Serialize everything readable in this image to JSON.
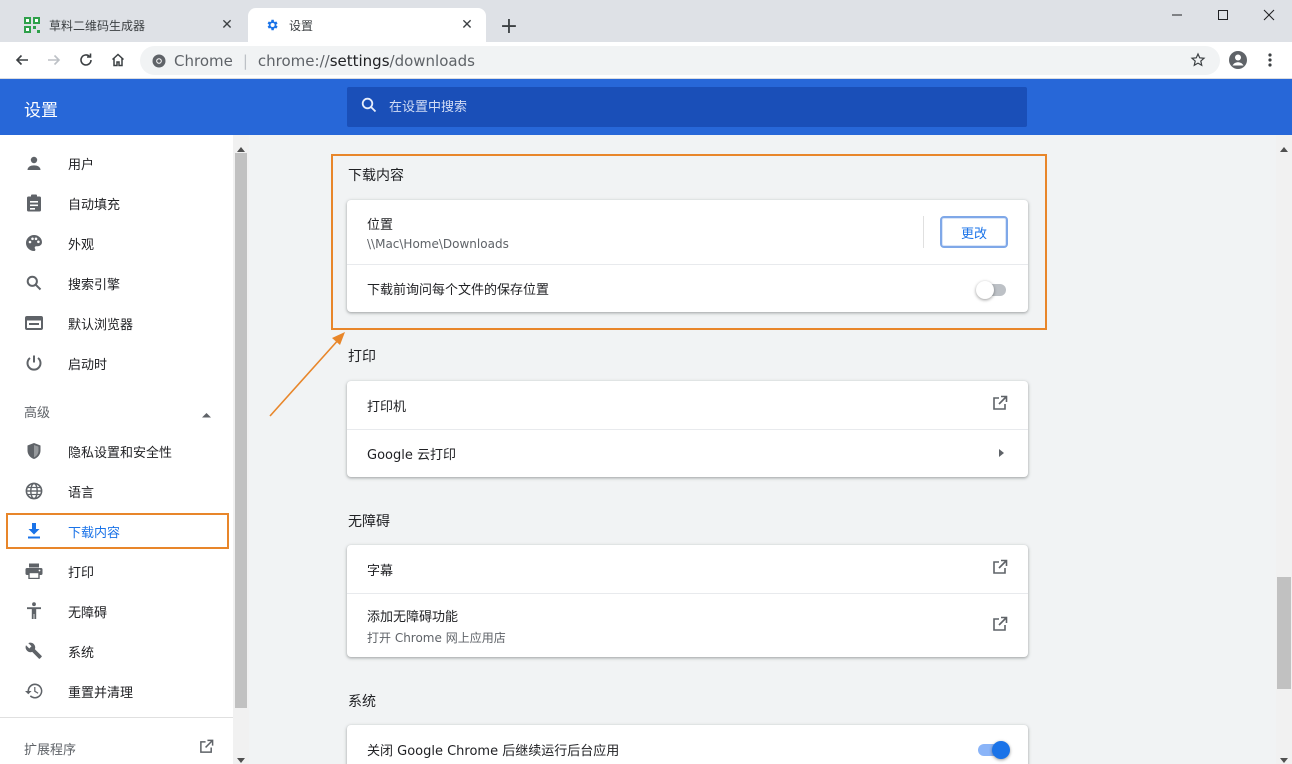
{
  "browser": {
    "tabs": [
      {
        "title": "草料二维码生成器",
        "active": false
      },
      {
        "title": "设置",
        "active": true
      }
    ],
    "omnibox": {
      "chip": "Chrome",
      "url_prefix": "chrome://",
      "url_host": "settings",
      "url_path": "/downloads"
    }
  },
  "header": {
    "title": "设置",
    "search_placeholder": "在设置中搜索"
  },
  "sidebar": {
    "items": [
      {
        "label": "用户",
        "icon": "person-icon"
      },
      {
        "label": "自动填充",
        "icon": "clipboard-icon"
      },
      {
        "label": "外观",
        "icon": "palette-icon"
      },
      {
        "label": "搜索引擎",
        "icon": "search-icon"
      },
      {
        "label": "默认浏览器",
        "icon": "browser-icon"
      },
      {
        "label": "启动时",
        "icon": "power-icon"
      }
    ],
    "advanced_label": "高级",
    "advanced_items": [
      {
        "label": "隐私设置和安全性",
        "icon": "shield-icon"
      },
      {
        "label": "语言",
        "icon": "globe-icon"
      },
      {
        "label": "下载内容",
        "icon": "download-icon",
        "selected": true
      },
      {
        "label": "打印",
        "icon": "printer-icon"
      },
      {
        "label": "无障碍",
        "icon": "accessibility-icon"
      },
      {
        "label": "系统",
        "icon": "wrench-icon"
      },
      {
        "label": "重置并清理",
        "icon": "history-icon"
      }
    ],
    "extensions_label": "扩展程序"
  },
  "main": {
    "downloads": {
      "title": "下载内容",
      "location_label": "位置",
      "location_value": "\\\\Mac\\Home\\Downloads",
      "change_button": "更改",
      "ask_label": "下载前询问每个文件的保存位置",
      "ask_enabled": false
    },
    "printing": {
      "title": "打印",
      "printers_label": "打印机",
      "cloud_print_label": "Google 云打印"
    },
    "accessibility": {
      "title": "无障碍",
      "captions_label": "字幕",
      "add_features_label": "添加无障碍功能",
      "add_features_sub": "打开 Chrome 网上应用店"
    },
    "system": {
      "title": "系统",
      "background_apps_label": "关闭 Google Chrome 后继续运行后台应用",
      "background_apps_enabled": true
    }
  },
  "colors": {
    "header": "#2767d8",
    "accent": "#1a73e8",
    "annotation": "#e8862a"
  }
}
